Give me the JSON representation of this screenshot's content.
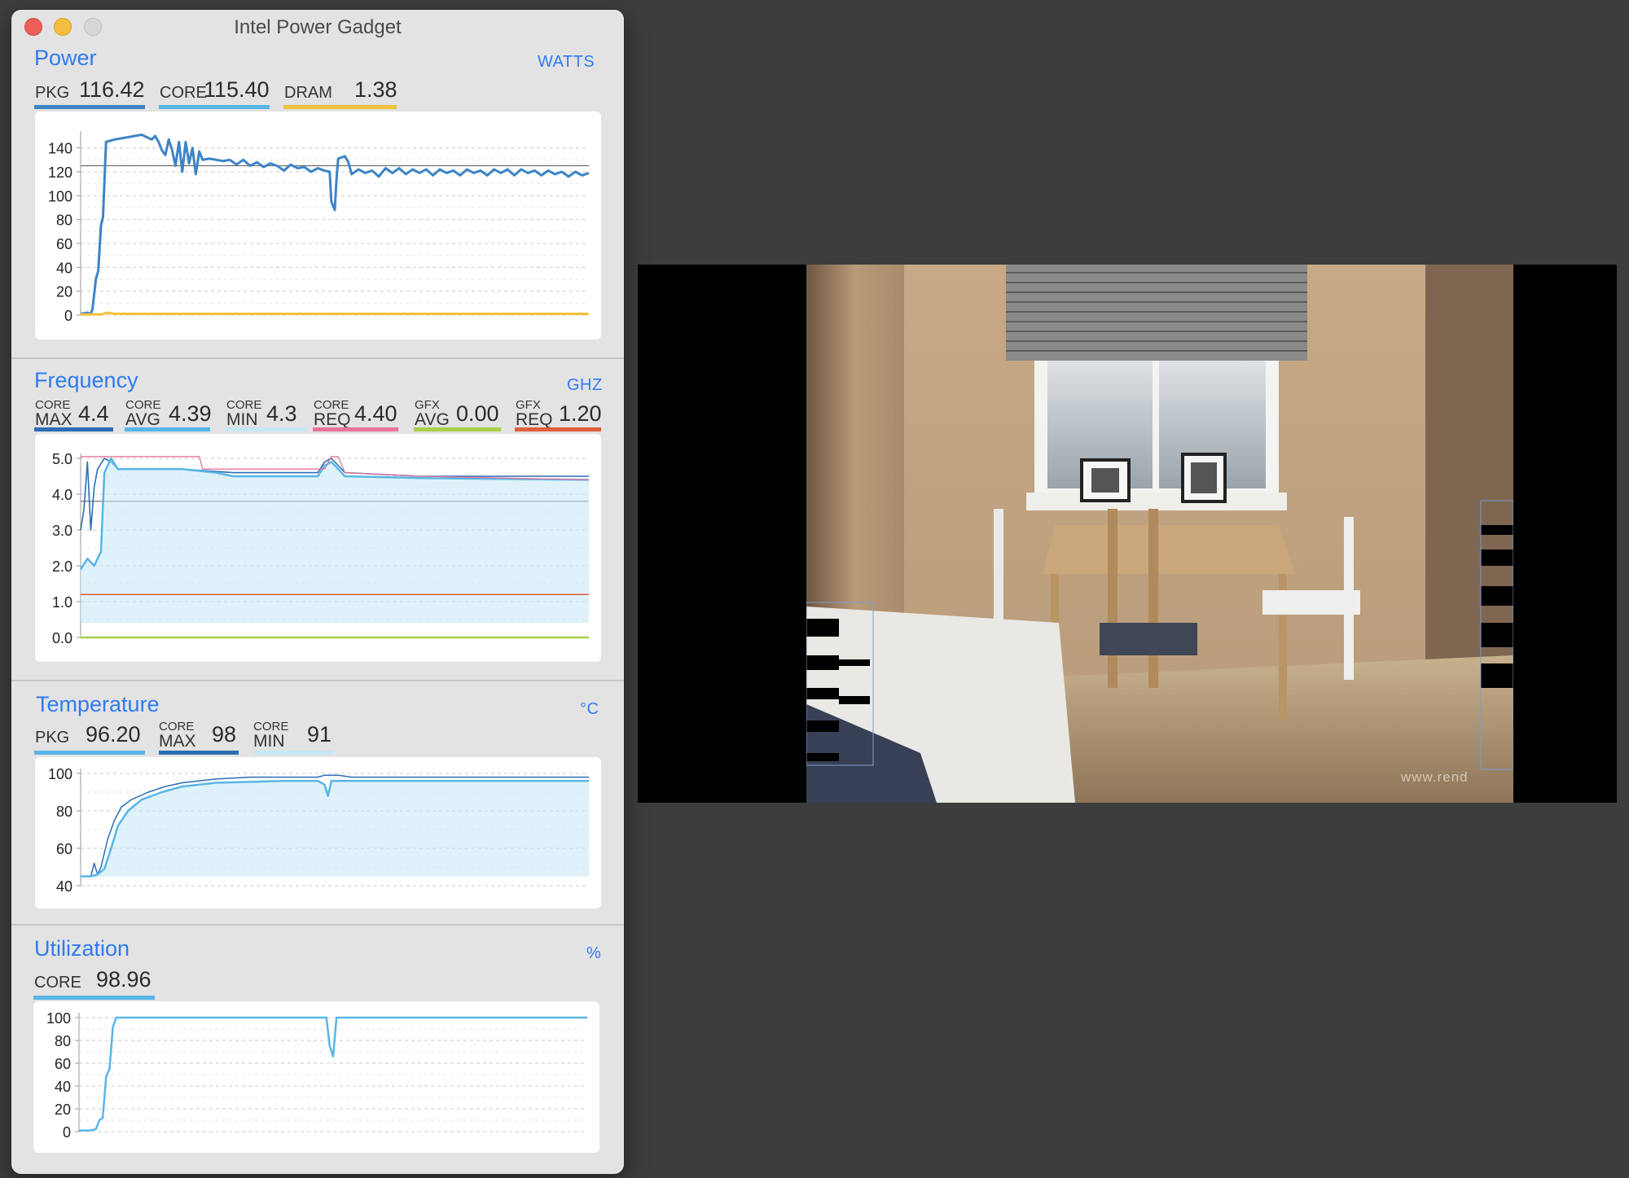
{
  "window": {
    "title": "Intel Power Gadget"
  },
  "colors": {
    "accent": "#2f7bf3",
    "pkg_power": "#3d84c6",
    "core_power": "#58b6e6",
    "dram": "#f2c23a",
    "freq_max": "#2c6db3",
    "freq_avg": "#58b6e6",
    "freq_min_fill": "#c5e7f6",
    "freq_req": "#e9749a",
    "gfx_avg": "#a9cf47",
    "gfx_req": "#e05e3c"
  },
  "power": {
    "title": "Power",
    "unit": "WATTS",
    "metrics": [
      {
        "label": "PKG",
        "value": "116.42"
      },
      {
        "label": "CORE",
        "value": "115.40"
      },
      {
        "label": "DRAM",
        "value": "1.38"
      }
    ]
  },
  "frequency": {
    "title": "Frequency",
    "unit": "GHZ",
    "metrics": [
      {
        "top": "CORE",
        "bottom": "MAX",
        "value": "4.4"
      },
      {
        "top": "CORE",
        "bottom": "AVG",
        "value": "4.39"
      },
      {
        "top": "CORE",
        "bottom": "MIN",
        "value": "4.3"
      },
      {
        "top": "CORE",
        "bottom": "REQ",
        "value": "4.40"
      },
      {
        "top": "GFX",
        "bottom": "AVG",
        "value": "0.00"
      },
      {
        "top": "GFX",
        "bottom": "REQ",
        "value": "1.20"
      }
    ]
  },
  "temperature": {
    "title": "Temperature",
    "unit": "°C",
    "metrics": [
      {
        "label": "PKG",
        "value": "96.20"
      },
      {
        "top": "CORE",
        "bottom": "MAX",
        "value": "98"
      },
      {
        "top": "CORE",
        "bottom": "MIN",
        "value": "91"
      }
    ]
  },
  "utilization": {
    "title": "Utilization",
    "unit": "%",
    "metrics": [
      {
        "label": "CORE",
        "value": "98.96"
      }
    ]
  },
  "photo": {
    "watermark": "www.rend"
  },
  "chart_data": [
    {
      "id": "power",
      "type": "line",
      "ylim": [
        0,
        150
      ],
      "yticks": [
        0,
        20,
        40,
        60,
        80,
        100,
        120,
        140
      ],
      "grid": true,
      "reference_line": 125,
      "series": [
        {
          "points": [
            [
              0,
              1
            ],
            [
              2,
              2
            ],
            [
              3,
              1
            ],
            [
              3.5,
              5
            ],
            [
              4.5,
              30
            ],
            [
              5.2,
              37
            ],
            [
              6,
              75
            ],
            [
              6.6,
              82
            ],
            [
              7.5,
              145
            ],
            [
              10,
              147
            ],
            [
              14,
              149
            ],
            [
              18,
              151
            ],
            [
              21,
              147
            ],
            [
              22,
              150
            ],
            [
              23,
              145
            ],
            [
              24,
              138
            ],
            [
              25,
              134
            ],
            [
              26,
              147
            ],
            [
              27,
              138
            ],
            [
              28,
              125
            ],
            [
              29,
              145
            ],
            [
              30,
              120
            ],
            [
              31,
              145
            ],
            [
              32,
              127
            ],
            [
              33,
              140
            ],
            [
              34,
              118
            ],
            [
              35,
              137
            ],
            [
              36,
              130
            ],
            [
              38,
              131
            ],
            [
              40,
              130
            ],
            [
              42,
              129
            ],
            [
              44,
              130
            ],
            [
              46,
              126
            ],
            [
              48,
              130
            ],
            [
              50,
              125
            ],
            [
              52,
              128
            ],
            [
              54,
              124
            ],
            [
              56,
              127
            ],
            [
              58,
              125
            ],
            [
              60,
              121
            ],
            [
              62,
              126
            ],
            [
              64,
              123
            ],
            [
              66,
              124
            ],
            [
              68,
              120
            ],
            [
              70,
              123
            ],
            [
              72,
              121
            ],
            [
              73.5,
              120
            ],
            [
              74,
              95
            ],
            [
              75,
              88
            ],
            [
              75.5,
              113
            ],
            [
              76,
              131
            ],
            [
              78,
              133
            ],
            [
              79,
              128
            ],
            [
              80,
              118
            ],
            [
              82,
              122
            ],
            [
              84,
              119
            ],
            [
              86,
              121
            ],
            [
              88,
              116
            ],
            [
              90,
              123
            ],
            [
              92,
              119
            ],
            [
              94,
              123
            ],
            [
              96,
              118
            ],
            [
              98,
              122
            ],
            [
              100,
              119
            ],
            [
              102,
              122
            ],
            [
              104,
              117
            ],
            [
              106,
              122
            ],
            [
              108,
              119
            ],
            [
              110,
              121
            ],
            [
              112,
              117
            ],
            [
              114,
              122
            ],
            [
              116,
              119
            ],
            [
              118,
              121
            ],
            [
              120,
              117
            ],
            [
              122,
              122
            ],
            [
              124,
              119
            ],
            [
              126,
              122
            ],
            [
              128,
              117
            ],
            [
              130,
              122
            ],
            [
              132,
              119
            ],
            [
              134,
              121
            ],
            [
              136,
              117
            ],
            [
              138,
              121
            ],
            [
              140,
              118
            ],
            [
              142,
              120
            ],
            [
              144,
              116
            ],
            [
              146,
              120
            ],
            [
              148,
              117
            ],
            [
              150,
              119
            ]
          ]
        },
        {
          "points": [
            [
              0,
              0.5
            ],
            [
              6,
              0.5
            ],
            [
              8,
              2
            ],
            [
              10,
              1
            ],
            [
              150,
              1
            ]
          ]
        }
      ]
    },
    {
      "id": "frequency",
      "type": "line",
      "ylim": [
        0,
        5
      ],
      "yticks": [
        0.0,
        1.0,
        2.0,
        3.0,
        4.0,
        5.0
      ],
      "grid": true,
      "reference_line": 3.8,
      "series": [
        {
          "points": [
            [
              0,
              3.0
            ],
            [
              1,
              3.6
            ],
            [
              2,
              4.9
            ],
            [
              3,
              3.0
            ],
            [
              4,
              4.2
            ],
            [
              5,
              4.7
            ],
            [
              7,
              5.0
            ],
            [
              9,
              4.9
            ],
            [
              11,
              4.7
            ],
            [
              30,
              4.7
            ],
            [
              45,
              4.6
            ],
            [
              70,
              4.6
            ],
            [
              72,
              4.9
            ],
            [
              74,
              5.0
            ],
            [
              76,
              4.8
            ],
            [
              78,
              4.6
            ],
            [
              100,
              4.5
            ],
            [
              150,
              4.5
            ]
          ]
        },
        {
          "points": [
            [
              0,
              1.9
            ],
            [
              2,
              2.2
            ],
            [
              4,
              2.0
            ],
            [
              6,
              2.4
            ],
            [
              7,
              4.6
            ],
            [
              9,
              5.0
            ],
            [
              11,
              4.7
            ],
            [
              30,
              4.7
            ],
            [
              40,
              4.6
            ],
            [
              45,
              4.5
            ],
            [
              70,
              4.5
            ],
            [
              72,
              4.8
            ],
            [
              74,
              4.9
            ],
            [
              76,
              4.7
            ],
            [
              78,
              4.5
            ],
            [
              100,
              4.45
            ],
            [
              150,
              4.4
            ]
          ]
        },
        {
          "points": [
            [
              0,
              5.05
            ],
            [
              2,
              5.05
            ],
            [
              3,
              5.05
            ],
            [
              4,
              5.05
            ],
            [
              5,
              5.05
            ],
            [
              6,
              5.05
            ],
            [
              7,
              5.05
            ],
            [
              35,
              5.05
            ],
            [
              36,
              4.7
            ],
            [
              72,
              4.7
            ],
            [
              74,
              5.05
            ],
            [
              76,
              5.05
            ],
            [
              78,
              4.6
            ],
            [
              100,
              4.5
            ],
            [
              150,
              4.4
            ]
          ]
        },
        {
          "points": [
            [
              0,
              1.2
            ],
            [
              150,
              1.2
            ]
          ]
        },
        {
          "points": [
            [
              0,
              0.0
            ],
            [
              150,
              0.0
            ]
          ]
        }
      ]
    },
    {
      "id": "temperature",
      "type": "line",
      "ylim": [
        40,
        100
      ],
      "yticks": [
        40,
        60,
        80,
        100
      ],
      "grid": true,
      "series": [
        {
          "points": [
            [
              0,
              45
            ],
            [
              3,
              45
            ],
            [
              4,
              52
            ],
            [
              5,
              46
            ],
            [
              6,
              50
            ],
            [
              8,
              65
            ],
            [
              10,
              75
            ],
            [
              12,
              82
            ],
            [
              15,
              86
            ],
            [
              20,
              90
            ],
            [
              25,
              93
            ],
            [
              30,
              95
            ],
            [
              40,
              97
            ],
            [
              50,
              98
            ],
            [
              60,
              98
            ],
            [
              70,
              98
            ],
            [
              72,
              99
            ],
            [
              74,
              99
            ],
            [
              76,
              99
            ],
            [
              80,
              98
            ],
            [
              100,
              98
            ],
            [
              150,
              98
            ]
          ]
        },
        {
          "points": [
            [
              0,
              45
            ],
            [
              3,
              45
            ],
            [
              5,
              46
            ],
            [
              7,
              49
            ],
            [
              9,
              60
            ],
            [
              11,
              72
            ],
            [
              14,
              80
            ],
            [
              18,
              86
            ],
            [
              24,
              90
            ],
            [
              30,
              93
            ],
            [
              40,
              95
            ],
            [
              60,
              96
            ],
            [
              70,
              96
            ],
            [
              72,
              94
            ],
            [
              73,
              88
            ],
            [
              74,
              96
            ],
            [
              80,
              96
            ],
            [
              100,
              96
            ],
            [
              150,
              96
            ]
          ]
        }
      ]
    },
    {
      "id": "utilization",
      "type": "line",
      "ylim": [
        0,
        100
      ],
      "yticks": [
        0,
        20,
        40,
        60,
        80,
        100
      ],
      "grid": true,
      "series": [
        {
          "points": [
            [
              0,
              1
            ],
            [
              3,
              1
            ],
            [
              5,
              2
            ],
            [
              6,
              10
            ],
            [
              7,
              12
            ],
            [
              8,
              48
            ],
            [
              9,
              55
            ],
            [
              10,
              92
            ],
            [
              11,
              100
            ],
            [
              73,
              100
            ],
            [
              74,
              75
            ],
            [
              75,
              66
            ],
            [
              76,
              100
            ],
            [
              150,
              100
            ]
          ]
        }
      ]
    }
  ]
}
